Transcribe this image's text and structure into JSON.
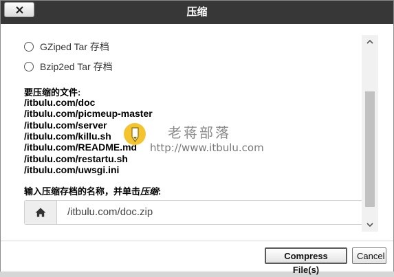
{
  "dialog": {
    "title": "压缩",
    "options": [
      {
        "label": "GZiped Tar 存档",
        "checked": false
      },
      {
        "label": "Bzip2ed Tar 存档",
        "checked": false
      }
    ],
    "files_label": "要压缩的文件:",
    "files": [
      "/itbulu.com/doc",
      "/itbulu.com/picmeup-master",
      "/itbulu.com/server",
      "/itbulu.com/killu.sh",
      "/itbulu.com/README.md",
      "/itbulu.com/restartu.sh",
      "/itbulu.com/uwsgi.ini"
    ],
    "name_label_prefix": "输入压缩存档的名称，并单击",
    "name_label_emph": "压缩",
    "name_label_suffix": ":",
    "archive_name": "/itbulu.com/doc.zip"
  },
  "watermark": {
    "title": "老蒋部落",
    "url": "http://www.itbulu.com"
  },
  "footer": {
    "compress_label": "Compress File(s)",
    "cancel_label": "Cancel"
  },
  "icons": {
    "close": "close-icon",
    "home": "home-icon",
    "scroll_up": "chevron-up-icon",
    "scroll_down": "chevron-down-icon"
  },
  "colors": {
    "titlebar": "#373737",
    "background": "#ffffff"
  }
}
